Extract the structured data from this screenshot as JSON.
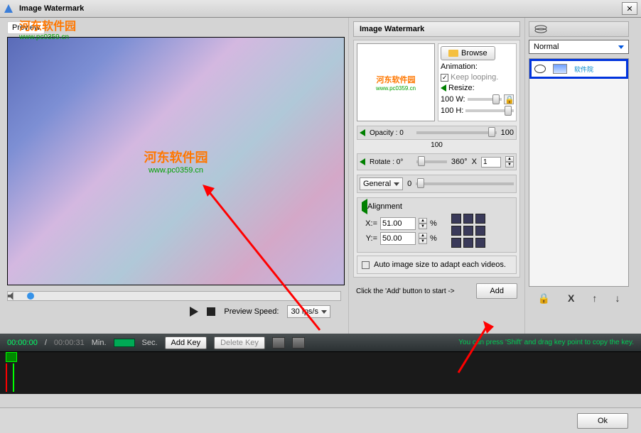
{
  "title_bar": {
    "title": "Image Watermark"
  },
  "top_watermark": {
    "main": "河东软件园",
    "sub": "www.pc0359.cn"
  },
  "preview": {
    "label": "Preview",
    "watermark_main": "河东软件园",
    "watermark_sub": "www.pc0359.cn",
    "speed_label": "Preview Speed:",
    "speed_value": "30 fps/s"
  },
  "settings": {
    "panel_title": "Image Watermark",
    "browse_label": "Browse",
    "thumb_main": "河东软件园",
    "thumb_sub": "www.pc0359.cn",
    "animation_label": "Animation:",
    "keep_looping": "Keep looping.",
    "resize_label": "Resize:",
    "resize_w_val": "100",
    "resize_w_unit": "W:",
    "resize_h_val": "100",
    "resize_h_unit": "H:",
    "opacity_label": "Opacity : 0",
    "opacity_max": "100",
    "opacity_value": "100",
    "rotate_label": "Rotate : 0°",
    "rotate_max": "360°",
    "rotate_x": "X",
    "rotate_value": "1",
    "general_label": "General",
    "general_value": "0",
    "alignment_label": "Alignment",
    "align_x_label": "X:=",
    "align_x_value": "51.00",
    "align_y_label": "Y:=",
    "align_y_value": "50.00",
    "percent": "%",
    "auto_label": "Auto image size to adapt each videos.",
    "add_hint": "Click the 'Add' button to start ->",
    "add_label": "Add"
  },
  "layers": {
    "mode": "Normal",
    "item_text": "软件院",
    "ctrl_lock": "🔒",
    "ctrl_delete": "X",
    "ctrl_up": "↑",
    "ctrl_down": "↓"
  },
  "timeline": {
    "tc_current": "00:00:00",
    "tc_sep": "/",
    "tc_total": "00:00:31",
    "min_label": "Min.",
    "sec_label": "Sec.",
    "add_key": "Add Key",
    "delete_key": "Delete Key",
    "hint": "You can press 'Shift' and drag key point to copy the key."
  },
  "footer": {
    "ok": "Ok"
  }
}
